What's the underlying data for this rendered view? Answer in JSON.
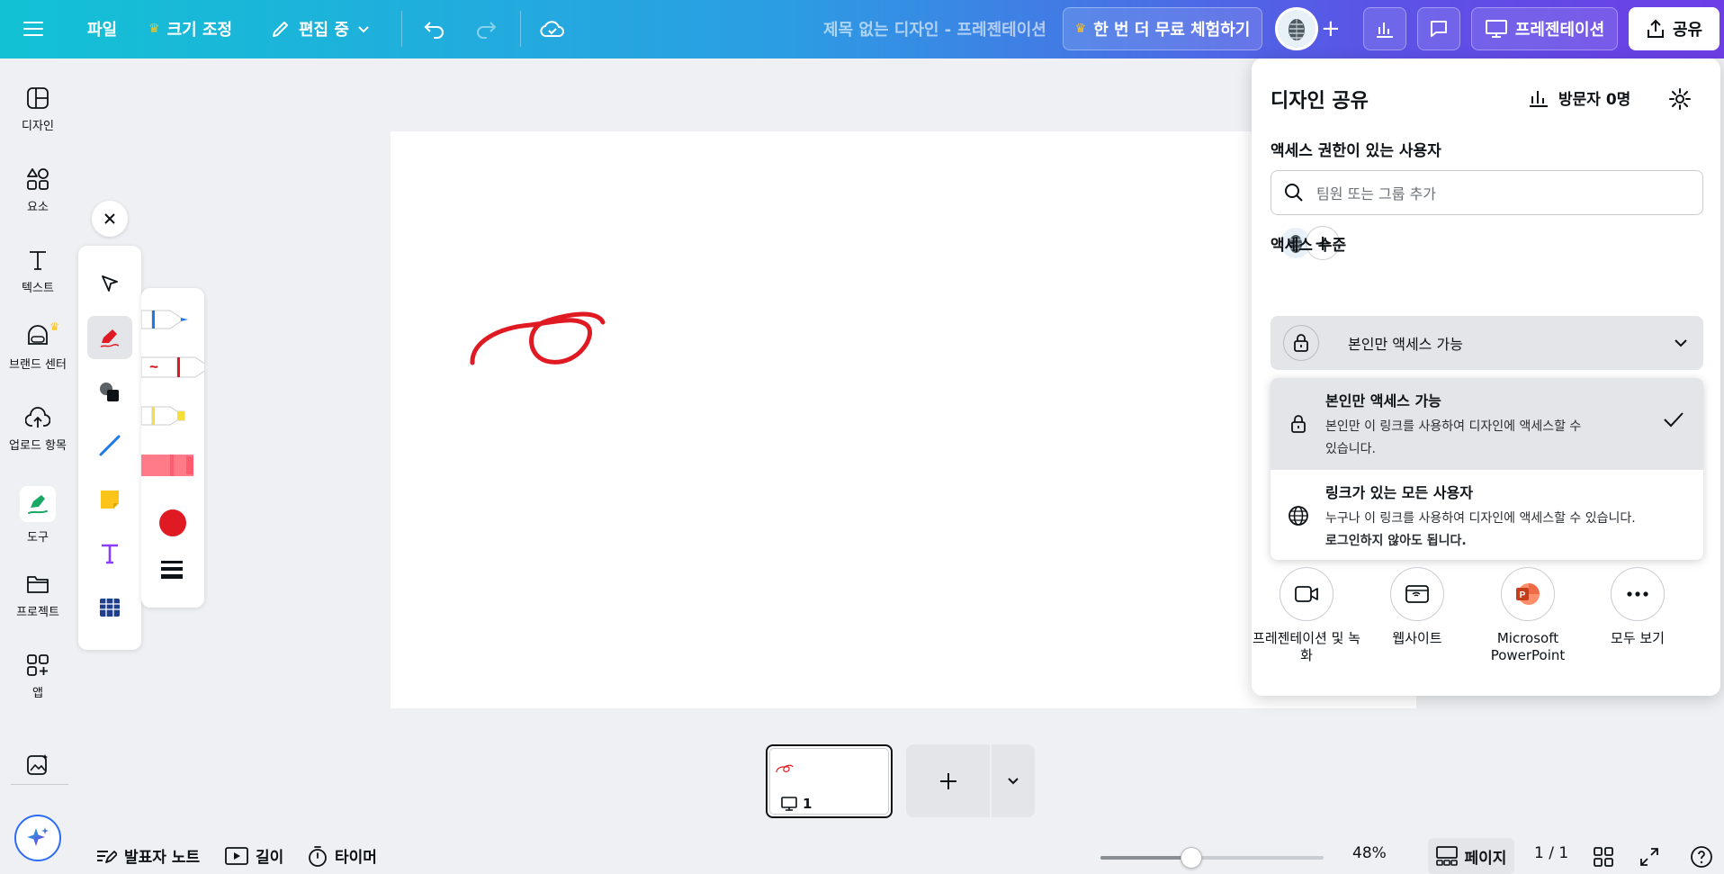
{
  "topbar": {
    "file_label": "파일",
    "resize_label": "크기 조정",
    "editing_label": "편집 중",
    "design_title": "제목 없는 디자인 - 프레젠테이션",
    "trial_label": "한 번 더 무료 체험하기",
    "present_label": "프레젠테이션",
    "share_label": "공유"
  },
  "sidebar": {
    "items": [
      {
        "label": "디자인",
        "icon": "layout-icon"
      },
      {
        "label": "요소",
        "icon": "elements-icon"
      },
      {
        "label": "텍스트",
        "icon": "text-icon"
      },
      {
        "label": "브랜드 센터",
        "icon": "brand-icon"
      },
      {
        "label": "업로드 항목",
        "icon": "upload-icon"
      },
      {
        "label": "도구",
        "icon": "draw-tool-icon"
      },
      {
        "label": "프로젝트",
        "icon": "folder-icon"
      },
      {
        "label": "앱",
        "icon": "apps-icon"
      }
    ]
  },
  "share_panel": {
    "title": "디자인 공유",
    "visitors": "방문자 0명",
    "access_users_label": "액세스 권한이 있는 사용자",
    "search_placeholder": "팀원 또는 그룹 추가",
    "access_level_label": "액세스 수준",
    "selected_level": "본인만 액세스 가능",
    "options": [
      {
        "title": "본인만 액세스 가능",
        "desc": "본인만 이 링크를 사용하여 디자인에 액세스할 수 있습니다."
      },
      {
        "title": "링크가 있는 모든 사용자",
        "desc": "누구나 이 링크를 사용하여 디자인에 액세스할 수 있습니다.",
        "desc_bold": "로그인하지 않아도 됩니다."
      }
    ],
    "actions": [
      {
        "label": "프레젠테이션 및 녹화"
      },
      {
        "label": "웹사이트"
      },
      {
        "label": "Microsoft PowerPoint"
      },
      {
        "label": "모두 보기"
      }
    ]
  },
  "pages": {
    "thumb_number": "1"
  },
  "footer": {
    "notes_label": "발표자 노트",
    "duration_label": "길이",
    "timer_label": "타이머",
    "zoom": "48%",
    "zoom_fraction": 0.48,
    "pages_label": "페이지",
    "page_count": "1 / 1"
  },
  "colors": {
    "accent": "#7d2ae8",
    "pen_red": "#e01a22",
    "pen_blue": "#1e7be6",
    "highlighter_yellow": "#f5e03a",
    "marker_pink": "#ff7b8a"
  }
}
